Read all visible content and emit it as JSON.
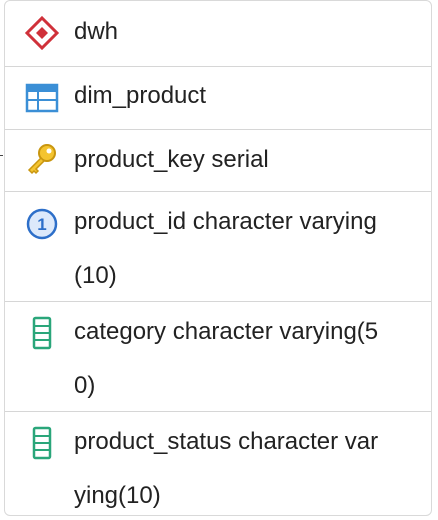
{
  "schema": {
    "name": "dwh",
    "icon": "schema-diamond-icon"
  },
  "table": {
    "name": "dim_product",
    "icon": "table-grid-icon"
  },
  "columns": [
    {
      "label": "product_key serial",
      "icon": "primary-key-icon"
    },
    {
      "label": "product_id character varying\n(10)",
      "icon": "unique-one-icon"
    },
    {
      "label": "category character varying(5\n0)",
      "icon": "column-icon"
    },
    {
      "label": "product_status character var\nying(10)",
      "icon": "column-icon"
    }
  ],
  "colors": {
    "schema": "#d0313a",
    "table": "#3b8fd6",
    "key": "#e6b21c",
    "unique": "#2d6fc9",
    "column": "#2aa67a",
    "divider": "#d6d6d6",
    "text": "#222222"
  }
}
